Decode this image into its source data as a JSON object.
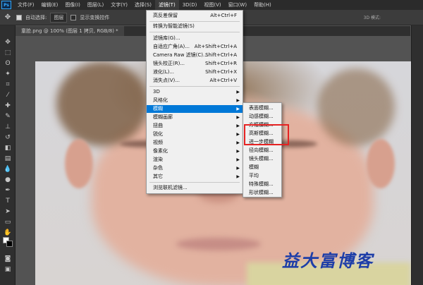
{
  "app": {
    "logo": "Ps"
  },
  "menubar": [
    "文件(F)",
    "编辑(E)",
    "图像(I)",
    "图层(L)",
    "文字(Y)",
    "选择(S)",
    "滤镜(T)",
    "3D(D)",
    "视图(V)",
    "窗口(W)",
    "帮助(H)"
  ],
  "options": {
    "auto_select_label": "自动选择:",
    "auto_select_value": "图层",
    "transform_label": "显示变换控件",
    "mode_3d": "3D 模式:"
  },
  "document": {
    "tab_label": "童脸.png @ 100% (图层 1 拷贝, RGB/8) *"
  },
  "filter_menu": {
    "items": [
      {
        "label": "高反差保留",
        "shortcut": "Alt+Ctrl+F"
      },
      {
        "label": "转换为智能滤镜(S)",
        "shortcut": ""
      },
      {
        "label": "滤镜库(G)...",
        "shortcut": ""
      },
      {
        "label": "自适应广角(A)...",
        "shortcut": "Alt+Shift+Ctrl+A"
      },
      {
        "label": "Camera Raw 滤镜(C)...",
        "shortcut": "Shift+Ctrl+A"
      },
      {
        "label": "镜头校正(R)...",
        "shortcut": "Shift+Ctrl+R"
      },
      {
        "label": "液化(L)...",
        "shortcut": "Shift+Ctrl+X"
      },
      {
        "label": "消失点(V)...",
        "shortcut": "Alt+Ctrl+V"
      },
      {
        "label": "3D",
        "shortcut": ""
      },
      {
        "label": "风格化",
        "shortcut": ""
      },
      {
        "label": "模糊",
        "shortcut": ""
      },
      {
        "label": "模糊画廊",
        "shortcut": ""
      },
      {
        "label": "扭曲",
        "shortcut": ""
      },
      {
        "label": "锐化",
        "shortcut": ""
      },
      {
        "label": "视频",
        "shortcut": ""
      },
      {
        "label": "像素化",
        "shortcut": ""
      },
      {
        "label": "渲染",
        "shortcut": ""
      },
      {
        "label": "杂色",
        "shortcut": ""
      },
      {
        "label": "其它",
        "shortcut": ""
      },
      {
        "label": "浏览联机滤镜...",
        "shortcut": ""
      }
    ]
  },
  "blur_submenu": {
    "items": [
      "表面模糊...",
      "动感模糊...",
      "方框模糊...",
      "高斯模糊...",
      "进一步模糊",
      "径向模糊...",
      "镜头模糊...",
      "模糊",
      "平均",
      "特殊模糊...",
      "形状模糊..."
    ]
  },
  "watermark": "益大富博客",
  "colors": {
    "menu_highlight": "#0078d7",
    "annotation": "#e52222"
  }
}
